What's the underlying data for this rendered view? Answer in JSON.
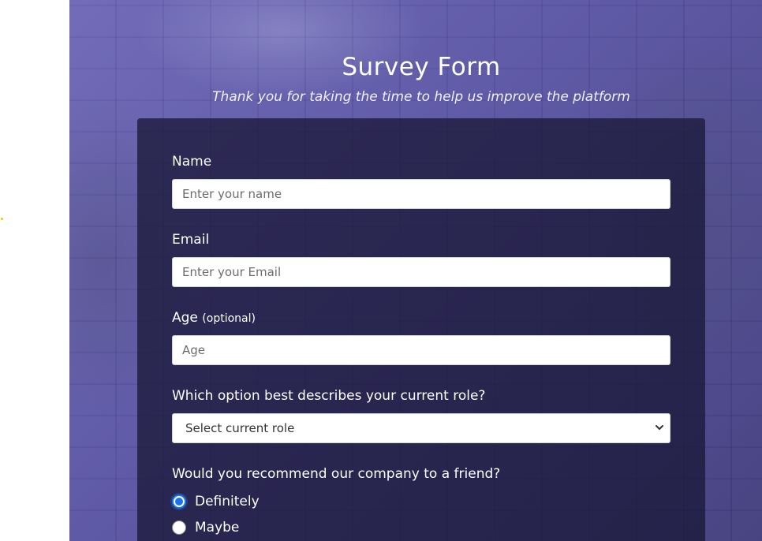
{
  "header": {
    "title": "Survey Form",
    "description": "Thank you for taking the time to help us improve the platform"
  },
  "form": {
    "name": {
      "label": "Name",
      "placeholder": "Enter your name",
      "value": ""
    },
    "email": {
      "label": "Email",
      "placeholder": "Enter your Email",
      "value": ""
    },
    "age": {
      "label": "Age",
      "optional_note": "(optional)",
      "placeholder": "Age",
      "value": ""
    },
    "role": {
      "label": "Which option best describes your current role?",
      "selected": "Select current role"
    },
    "recommend": {
      "label": "Would you recommend our company to a friend?",
      "options": [
        {
          "label": "Definitely",
          "checked": true
        },
        {
          "label": "Maybe",
          "checked": false
        }
      ]
    }
  },
  "colors": {
    "accent": "#1a73e8",
    "card": "#1b183a",
    "background": "#5a55a5",
    "gutter_dot": "#f2c200"
  },
  "icons": {
    "select_arrow": "chevron-down-icon"
  }
}
